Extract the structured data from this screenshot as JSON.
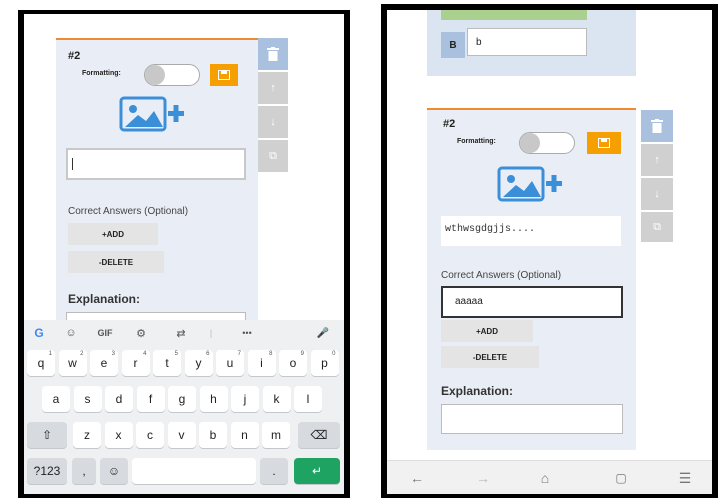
{
  "left": {
    "question_number": "#2",
    "formatting_label": "Formatting:",
    "text_input_value": "",
    "correct_answers_label": "Correct Answers (Optional)",
    "add_label": "+ADD",
    "delete_label": "-DELETE",
    "explanation_label": "Explanation:"
  },
  "keyboard": {
    "toolbar": [
      "G",
      "☺",
      "GIF",
      "⚙",
      "⇄",
      "|",
      "•••",
      "🎤"
    ],
    "row1": [
      {
        "k": "q",
        "n": "1"
      },
      {
        "k": "w",
        "n": "2"
      },
      {
        "k": "e",
        "n": "3"
      },
      {
        "k": "r",
        "n": "4"
      },
      {
        "k": "t",
        "n": "5"
      },
      {
        "k": "y",
        "n": "6"
      },
      {
        "k": "u",
        "n": "7"
      },
      {
        "k": "i",
        "n": "8"
      },
      {
        "k": "o",
        "n": "9"
      },
      {
        "k": "p",
        "n": "0"
      }
    ],
    "row2": [
      "a",
      "s",
      "d",
      "f",
      "g",
      "h",
      "j",
      "k",
      "l"
    ],
    "row3": [
      "z",
      "x",
      "c",
      "v",
      "b",
      "n",
      "m"
    ],
    "shift": "⇧",
    "backspace": "⌫",
    "num_key": "?123",
    "comma": ",",
    "emoji": "☺",
    "period": ".",
    "enter": "↵"
  },
  "right": {
    "option_b_letter": "B",
    "option_b_value": "b",
    "question_number": "#2",
    "formatting_label": "Formatting:",
    "answer_text": "wthwsgdgjjs....",
    "correct_answers_label": "Correct Answers (Optional)",
    "correct_answer_value": "aaaaa",
    "add_label": "+ADD",
    "delete_label": "-DELETE",
    "explanation_label": "Explanation:",
    "nav": [
      "←",
      "→",
      "⌂",
      "▢",
      "☰"
    ]
  },
  "colors": {
    "accent": "#f5a000",
    "trash": "#a9c1de",
    "card": "#e9eef6",
    "enter": "#1ea362"
  }
}
